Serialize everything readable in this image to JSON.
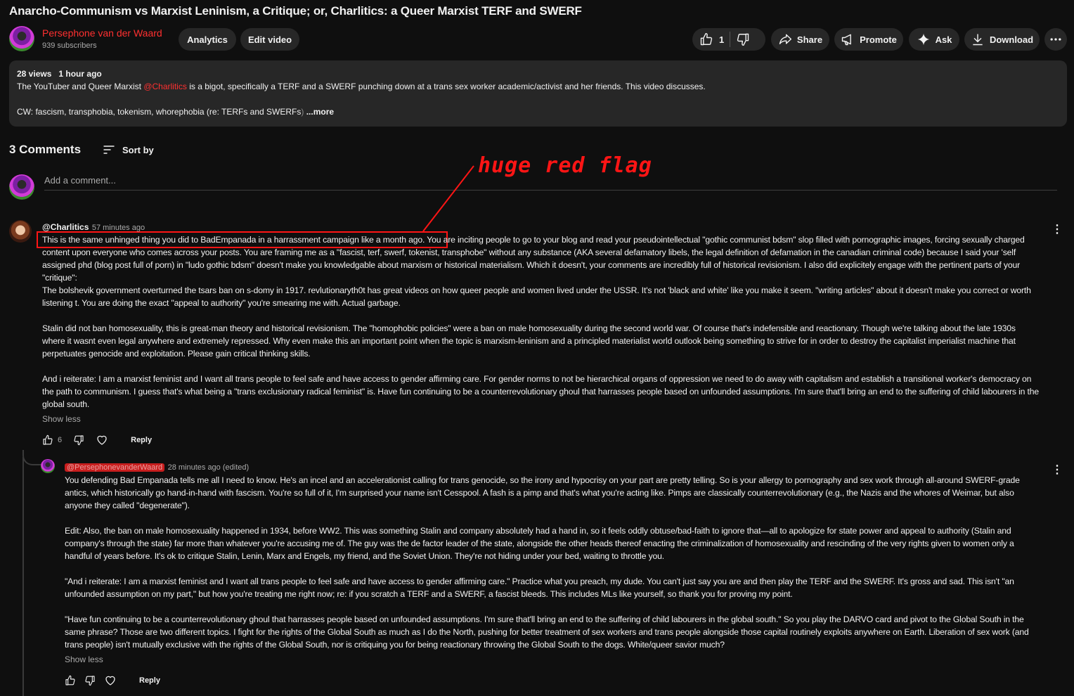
{
  "video": {
    "title": "Anarcho-Communism vs Marxist Leninism, a Critique; or, Charlitics: a Queer Marxist TERF and SWERF"
  },
  "channel": {
    "name": "Persephone van der Waard",
    "subscribers": "939 subscribers"
  },
  "owner_actions": {
    "analytics": "Analytics",
    "edit_video": "Edit video"
  },
  "actions": {
    "like_count": "1",
    "share": "Share",
    "promote": "Promote",
    "ask": "Ask",
    "download": "Download"
  },
  "description": {
    "views": "28 views",
    "age": "1 hour ago",
    "line1_pre": "The YouTuber and Queer Marxist ",
    "line1_mention": "@Charlitics",
    "line1_post": " is a bigot, specifically a TERF and a SWERF punching down at a trans sex worker academic/activist and her friends. This video discusses.",
    "line2_pre": "CW: fascism, transphobia, tokenism, whorephobia (re: TERFs and SWERFs",
    "line2_fade": ")",
    "more": " ...more"
  },
  "comments_header": {
    "count": "3 Comments",
    "sort": "Sort by"
  },
  "add_comment": {
    "placeholder": "Add a comment..."
  },
  "annotation": {
    "text": "huge red flag"
  },
  "comment1": {
    "author": "@Charlitics",
    "time": "57 minutes ago",
    "highlighted": "This is the same unhinged thing you did to BadEmpanada in a harrassment campaign like a month ago.",
    "p1_rest": " You are inciting people to go to your blog and read your pseudointellectual \"gothic communist bdsm\" slop filled with pornographic images, forcing sexually charged content upon everyone who comes across your posts. You are framing me as a \"fascist, terf, swerf, tokenist, transphobe\" without any substance (AKA several defamatory libels, the legal definition of defamation in the canadian criminal code) because I said your 'self assigned phd (blog post full of porn) in \"ludo gothic bdsm\" doesn't make you knowledgable about marxism or historical materialism. Which it doesn't, your comments are incredibly full of historical revisionism. I also did explicitely engage with the pertinent parts of your \"critique\":",
    "p1b": "The bolshevik government overturned the tsars ban on s-domy in 1917.  revlutionaryth0t has great videos on how queer people and women lived under the USSR. It's not 'black and white' like you make it seem.  \"writing articles\" about it doesn't make you correct or worth listening t. You are doing the exact \"appeal to authority\" you're smearing me with. Actual garbage.",
    "p2": "Stalin did not ban homosexuality, this is great-man theory and historical revisionism. The \"homophobic policies\" were a ban on male homosexuality during the second world war. Of course that's indefensible and reactionary. Though we're talking about the late 1930s where it wasnt even legal anywhere and extremely repressed. Why even make this an important point when the topic is marxism-leninism and a principled materialist world outlook being something to strive for in order to destroy the capitalist imperialist machine that perpetuates genocide and exploitation. Please gain critical thinking skills.",
    "p3": "And i reiterate: I am a marxist feminist and I want all trans people to feel safe and have access to gender affirming care. For gender norms to not be hierarchical organs of oppression we need to do away with capitalism and establish a transitional worker's democracy on the path to communism. I guess that's what being a \"trans exclusionary radical feminist\" is. Have fun continuing to be a counterrevolutionary ghoul that harrasses people based on unfounded assumptions. I'm sure that'll bring an end to the suffering of child labourers in the global south.",
    "show_less": "Show less",
    "likes": "6",
    "reply": "Reply"
  },
  "reply1": {
    "author": "@PersephonevanderWaard",
    "time": "28 minutes ago (edited)",
    "p1": "You defending Bad Empanada tells me all I need to know. He's an incel and an accelerationist calling for trans genocide, so the irony and hypocrisy on your part are pretty telling. So is your allergy to pornography and sex work through all-around SWERF-grade antics, which historically go hand-in-hand with fascism. You're so full of it, I'm surprised your name isn't Cesspool. A fash is a pimp and that's what you're acting like. Pimps are classically counterrevolutionary (e.g., the Nazis and the whores of Weimar, but also anyone they called \"degenerate\").",
    "p2": "Edit: Also, the ban on male homosexuality happened in 1934, before WW2. This was something Stalin and company absolutely had a hand in, so it feels oddly obtuse/bad-faith to ignore that—all to apologize for state power and appeal to authority (Stalin and company's through the state) far more than whatever you're accusing me of. The guy was the de factor leader of the state, alongside the other heads thereof enacting the criminalization of homosexuality and rescinding of the very rights given to women only a handful of years before. It's ok to critique Stalin, Lenin, Marx and Engels, my friend, and the Soviet Union. They're not hiding under your bed, waiting to throttle you.",
    "p3": "\"And i reiterate: I am a marxist feminist and I want all trans people to feel safe and have access to gender affirming care.\" Practice what you preach, my dude. You can't just say you are and then play the TERF and the SWERF. It's gross and sad. This isn't \"an unfounded assumption on my part,\" but how you're treating me right now; re: if you scratch a TERF and a SWERF, a fascist bleeds. This includes MLs like yourself, so thank you for proving my point.",
    "p4": "\"Have fun continuing to be a counterrevolutionary ghoul that harrasses people based on unfounded assumptions. I'm sure that'll bring an end to the suffering of child labourers in the global south.\" So you play the DARVO card and pivot to the Global South in the same phrase? Those are two different topics. I fight for the rights of the Global South as much as I do the North, pushing for better treatment of sex workers and trans people alongside those capital routinely exploits anywhere on Earth. Liberation of sex work (and trans people) isn't mutually exclusive with the rights of the Global South, nor is critiquing you for being reactionary throwing the Global South to the dogs. White/queer savior much?",
    "show_less": "Show less",
    "reply": "Reply"
  },
  "colors": {
    "background": "#0f0f0f",
    "surface": "#272727",
    "accent_red": "#ff1515",
    "channel_name": "#ff3030"
  }
}
